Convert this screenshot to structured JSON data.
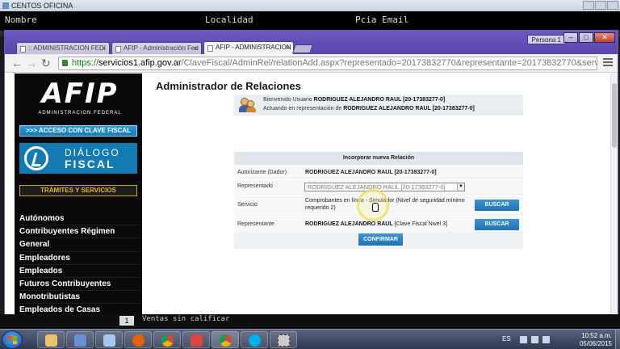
{
  "background_app": {
    "title": "CENTOS OFICINA",
    "columns": [
      "Nombre",
      "Localidad",
      "Pcia Email"
    ],
    "footer_number": "1",
    "footer_text": "Ventas sin calificar"
  },
  "browser": {
    "profile_button": "Persona 1",
    "tabs": [
      {
        "label": ":: ADMINISTRACION FEDI",
        "active": false
      },
      {
        "label": "AFIP - Administración Fed",
        "active": false
      },
      {
        "label": "AFIP - ADMINISTRACION",
        "active": true
      }
    ],
    "tab_close": "×",
    "url": {
      "scheme": "https://",
      "host": "servicios1.afip.gov.ar",
      "path": "/ClaveFiscal/AdminRel/relationAdd.aspx?representado=20173832770&representante=20173832770&servicename=web://rcel"
    },
    "nav": {
      "back": "←",
      "forward": "→",
      "reload": "↻"
    },
    "window_controls": {
      "minimize": "–",
      "maximize": "□",
      "close": "✕"
    }
  },
  "sidebar": {
    "logo_text": "AFIP",
    "logo_subtitle": "ADMINISTRACION FEDERAL",
    "clave_fiscal_button": ">>> ACCESO CON CLAVE FISCAL",
    "dialogo_line1": "DIÁLOGO",
    "dialogo_line2": "FISCAL",
    "tramites_button": "TRÁMITES Y SERVICIOS",
    "menu_items": [
      "Autónomos",
      "Contribuyentes Régimen",
      "General",
      "Empleadores",
      "Empleados",
      "Futuros Contribuyentes",
      "Monotributistas",
      "Empleados de Casas"
    ]
  },
  "main": {
    "page_title": "Administrador de Relaciones",
    "welcome_prefix": "Bienvenido Usuario ",
    "welcome_user": "RODRIGUEZ ALEJANDRO RAUL [20-17383277-0]",
    "acting_prefix": "Actuando en representación de ",
    "acting_user": "RODRIGUEZ ALEJANDRO RAUL [20-17383277-0]",
    "form_title": "Incorporar nueva Relación",
    "rows": {
      "autorizante_label": "Autorizante (Dador)",
      "autorizante_value": "RODRIGUEZ ALEJANDRO RAUL [20-17383277-0]",
      "representado_label": "Representado",
      "representado_selected": "RODRIGUEZ ALEJANDRO RAUL [20-17383277-0]",
      "servicio_label": "Servicio",
      "servicio_value_line1": "Comprobantes en línea - Simulador (Nivel de seguridad mínimo",
      "servicio_value_line2": "requerido 2)",
      "representante_label": "Representante",
      "representante_value_bold": "RODRIGUEZ ALEJANDRO RAUL",
      "representante_value_rest": " [Clave Fiscal Nivel 3]"
    },
    "buscar_label": "BUSCAR",
    "confirmar_label": "CONFIRMAR"
  },
  "taskbar": {
    "language": "ES",
    "time": "10:52 a.m.",
    "date": "05/06/2015"
  }
}
